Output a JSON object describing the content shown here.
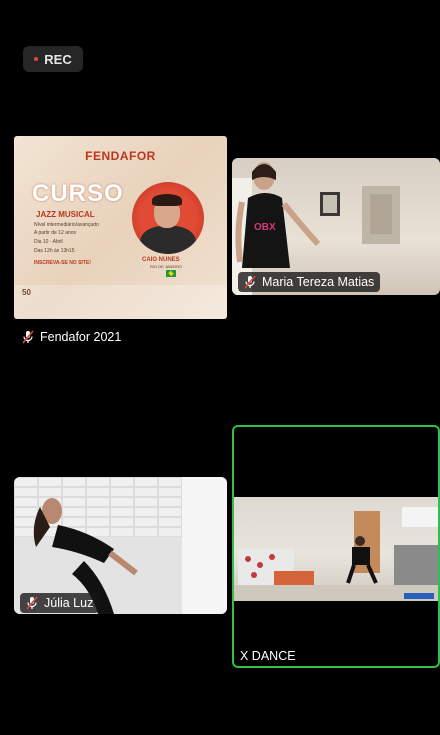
{
  "recording": {
    "label": "REC"
  },
  "participants": [
    {
      "name": "Fendafor 2021",
      "muted": true
    },
    {
      "name": "Maria Tereza Matias",
      "muted": true
    },
    {
      "name": "Júlia Luz",
      "muted": true
    },
    {
      "name": "X DANCE",
      "muted": false,
      "active_speaker": true
    }
  ],
  "poster": {
    "brand": "FENDAFOR",
    "course_title": "CURSO",
    "course_subtitle": "JAZZ MUSICAL",
    "level": "Nível intermediário/avançado",
    "age": "A partir de 12 anos",
    "date": "Dia 10 - Abril",
    "time": "Das 12h às 13h15",
    "signup": "INSCREVA-SE NO SITE!",
    "instructor": "CAIO NUNES",
    "city": "RIO DE JANEIRO",
    "badge": "50"
  },
  "colors": {
    "active_border": "#2fbf4a",
    "rec_dot": "#e0443e",
    "poster_accent": "#b9371f"
  }
}
